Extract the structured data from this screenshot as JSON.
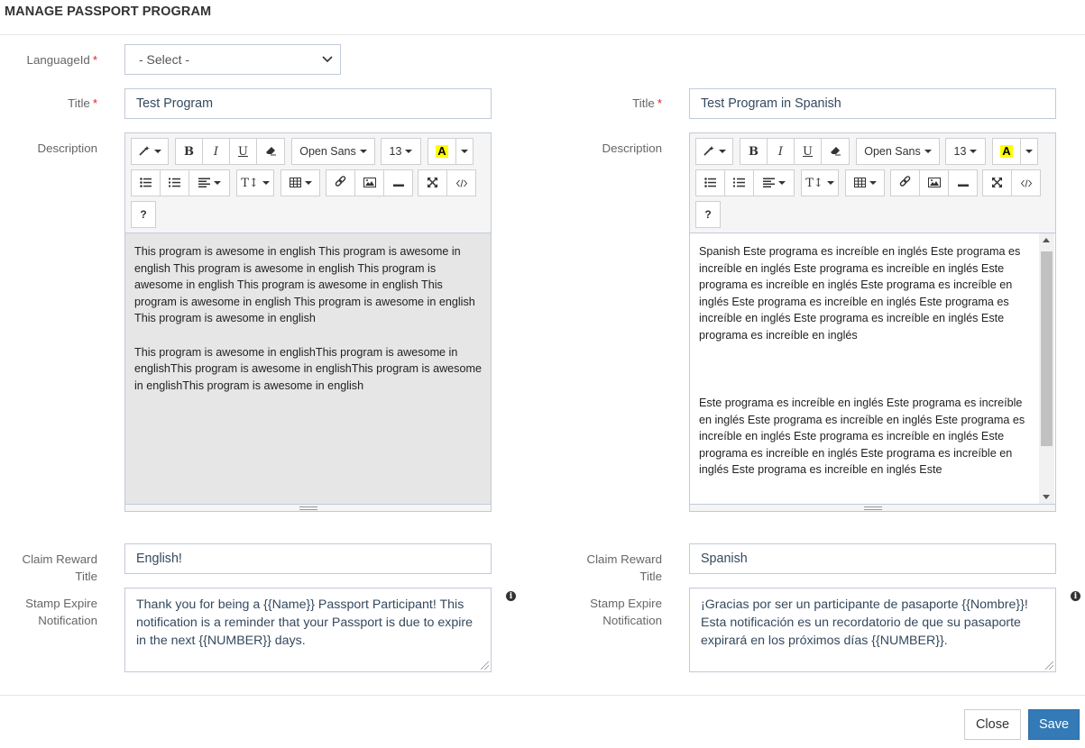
{
  "modal": {
    "title": "MANAGE PASSPORT PROGRAM"
  },
  "language": {
    "label": "LanguageId",
    "required_mark": "*",
    "selected": "- Select -"
  },
  "english": {
    "title_label": "Title",
    "title_value": "Test Program",
    "description_label": "Description",
    "description_paragraphs": [
      "This program is awesome in english This program is awesome in english This program is awesome in english This program is awesome in english This program is awesome in english This program is awesome in english This program is awesome in english This program is awesome in english",
      "This program is awesome in englishThis program is awesome in englishThis program is awesome in englishThis program is awesome in englishThis program is awesome in english"
    ],
    "claim_label": "Claim Reward Title",
    "claim_value": "English!",
    "stamp_label_line1": "Stamp Expire",
    "stamp_label_line2": "Notification",
    "stamp_value": "Thank you for being a {{Name}} Passport Participant! This notification is a reminder that your Passport is due to expire in the next {{NUMBER}} days."
  },
  "spanish": {
    "title_label": "Title",
    "title_value": "Test Program in Spanish",
    "description_label": "Description",
    "description_paragraphs": [
      "Spanish Este programa es increíble en inglés Este programa es increíble en inglés Este programa es increíble en inglés Este programa es increíble en inglés Este programa es increíble en inglés Este programa es increíble en inglés Este programa es increíble en inglés Este programa es increíble en inglés Este programa es increíble en inglés",
      "Este programa es increíble en inglés Este programa es increíble en inglés Este programa es increíble en inglés Este programa es increíble en inglés Este programa es increíble en inglés Este programa es increíble en inglés Este programa es increíble en inglés Este programa es increíble en inglés Este"
    ],
    "claim_label": "Claim Reward Title",
    "claim_value": "Spanish",
    "stamp_label_line1": "Stamp Expire",
    "stamp_label_line2": "Notification",
    "stamp_value": "¡Gracias por ser un participante de pasaporte {{Nombre}}! Esta notificación es un recordatorio de que su pasaporte expirará en los próximos días {{NUMBER}}."
  },
  "toolbar": {
    "bold": "B",
    "italic": "I",
    "underline": "U",
    "font_family": "Open Sans",
    "font_size": "13",
    "highlight": "A",
    "help": "?",
    "height": "T↕"
  },
  "icons": [
    "magic-icon",
    "bold-icon",
    "italic-icon",
    "underline-icon",
    "eraser-icon",
    "unordered-list-icon",
    "ordered-list-icon",
    "align-icon",
    "line-height-icon",
    "table-icon",
    "link-icon",
    "image-icon",
    "hr-icon",
    "fullscreen-icon",
    "code-icon",
    "help-icon",
    "info-icon",
    "chevron-down-icon"
  ],
  "colors": {
    "primary": "#337ab7",
    "required": "#e02222",
    "highlight": "#ffff00"
  },
  "footer": {
    "close": "Close",
    "save": "Save"
  }
}
